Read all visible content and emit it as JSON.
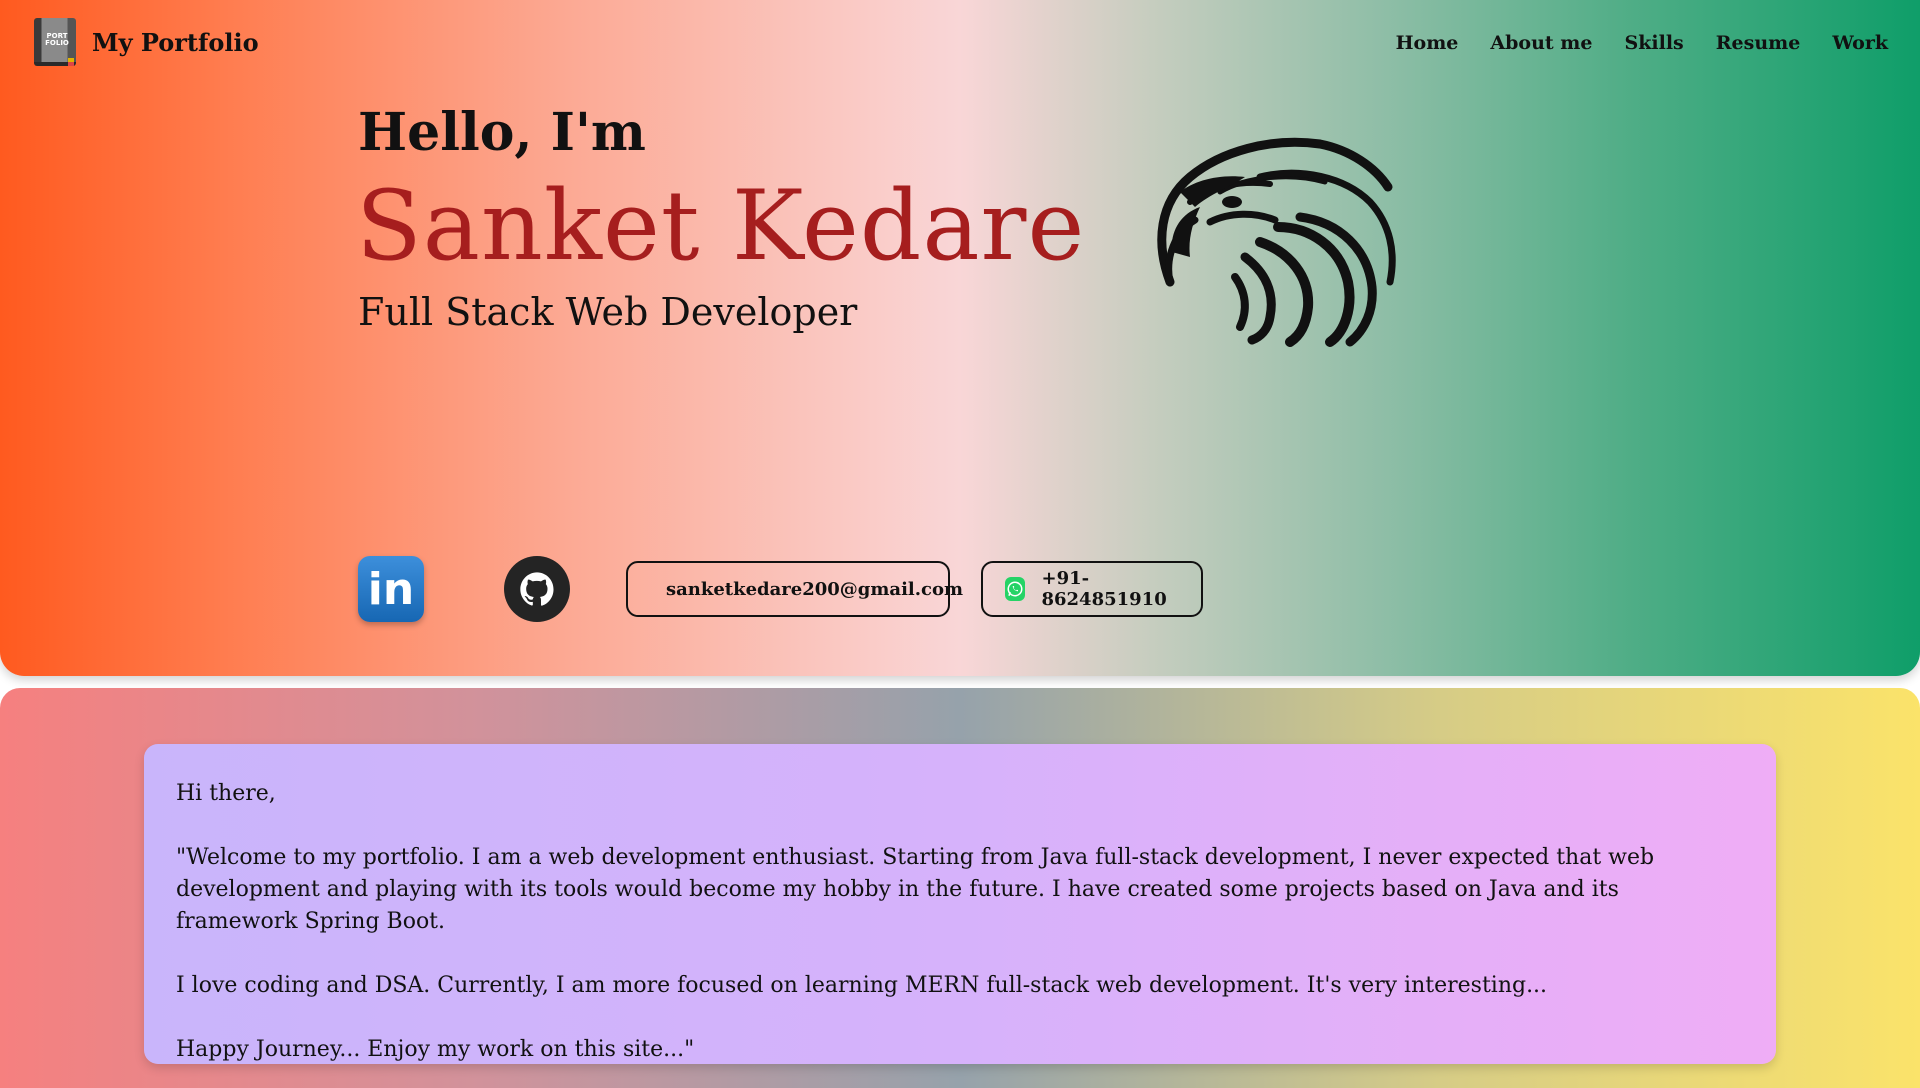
{
  "header": {
    "logo_text": "PORT FOLIO",
    "brand": "My Portfolio",
    "nav": [
      "Home",
      "About me",
      "Skills",
      "Resume",
      "Work"
    ]
  },
  "hero": {
    "greeting": "Hello, I'm",
    "name": "Sanket Kedare",
    "role": "Full Stack Web Developer",
    "eagle_icon": "eagle-head-icon",
    "socials": {
      "linkedin_label": "in",
      "linkedin_icon": "linkedin-icon",
      "github_icon": "github-icon",
      "email": "sanketkedare200@gmail.com",
      "phone": "+91-8624851910"
    }
  },
  "about": {
    "greeting": "Hi there,",
    "para1": "\"Welcome to my portfolio. I am a web development enthusiast. Starting from Java full-stack development, I never expected that web development and playing with its tools would become my hobby in the future. I have created some projects based on Java and its framework Spring Boot.",
    "para2": "I love coding and DSA. Currently, I am more focused on learning MERN full-stack web development. It's very interesting...",
    "para3": "Happy Journey... Enjoy my work on this site...\""
  },
  "colors": {
    "name_color": "#a61e1e",
    "hero_start": "#ff5a1f",
    "hero_end": "#0f9e69"
  }
}
